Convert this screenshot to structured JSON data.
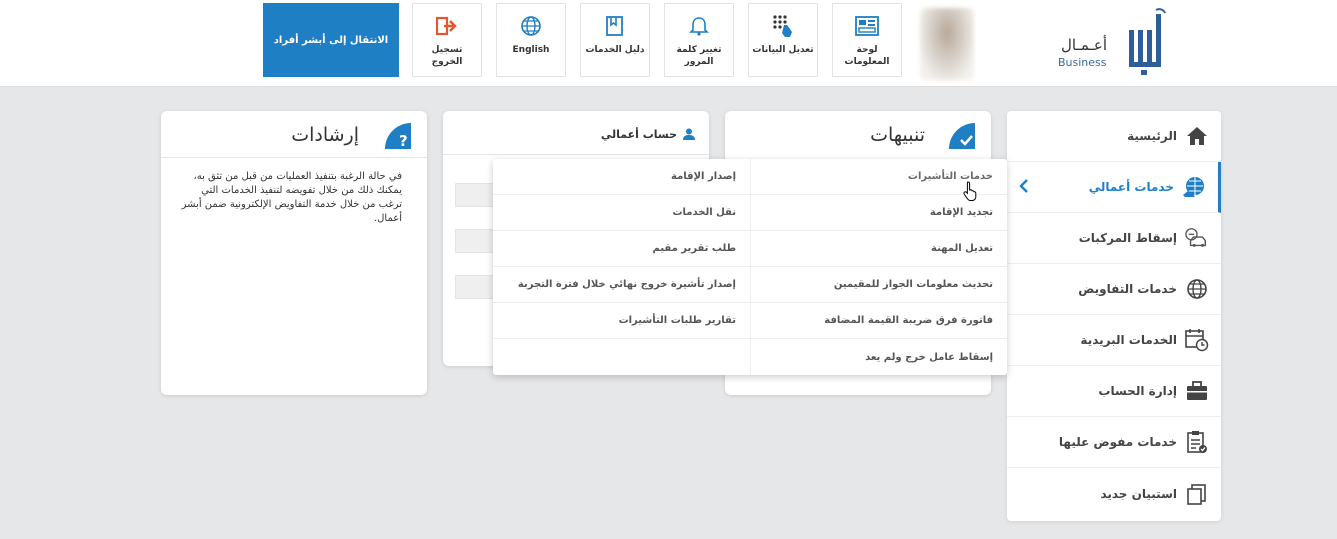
{
  "header": {
    "absher_button": "الانتقال إلى أبشر أفراد",
    "tiles": {
      "logout": "تسجيل الخروج",
      "english": "English",
      "services_guide": "دليل الخدمات",
      "change_password": "تغيير كلمة المرور",
      "edit_data": "تعديل البيانات",
      "info_board": "لوحة المعلومات"
    },
    "logo": {
      "arabic": "أعـمـال",
      "english": "Business"
    }
  },
  "cards": {
    "guidance_title": "إرشادات",
    "guidance_text": "في حالة الرغبة بتنفيذ العمليات من قبل من تثق به، يمكنك ذلك من خلال تفويضه لتنفيذ الخدمات التي ترغب من خلال خدمة التفاويض الإلكترونية ضمن أبشر أعمال.",
    "account_title": "حساب أعمالي",
    "alerts_title": "تنبيهات"
  },
  "sidebar": {
    "items": [
      {
        "label": "الرئيسية",
        "icon": "home-icon"
      },
      {
        "label": "خدمات أعمالي",
        "icon": "globe-hand-icon"
      },
      {
        "label": "إسقاط المركبات",
        "icon": "car-icon"
      },
      {
        "label": "خدمات التفاويض",
        "icon": "globe-icon"
      },
      {
        "label": "الخدمات البريدية",
        "icon": "calendar-clock-icon"
      },
      {
        "label": "إدارة الحساب",
        "icon": "briefcase-icon"
      },
      {
        "label": "خدمات مفوض عليها",
        "icon": "clipboard-check-icon"
      },
      {
        "label": "استبيان جديد",
        "icon": "copy-icon"
      }
    ]
  },
  "dropdown": {
    "right_column": [
      "خدمات التأشيرات",
      "تجديد الإقامة",
      "تعديل المهنة",
      "تحديث معلومات الجواز للمقيمين",
      "فاتورة فرق ضريبة القيمة المضافة",
      "إسقاط عامل خرج ولم يعد"
    ],
    "left_column": [
      "إصدار الإقامة",
      "نقل الخدمات",
      "طلب تقرير مقيم",
      "إصدار تأشيرة خروج نهائي خلال فترة التجربة",
      "تقارير طلبات التأشيرات",
      ""
    ]
  },
  "colors": {
    "accent": "#1f7fc4",
    "logout": "#e4572e"
  }
}
